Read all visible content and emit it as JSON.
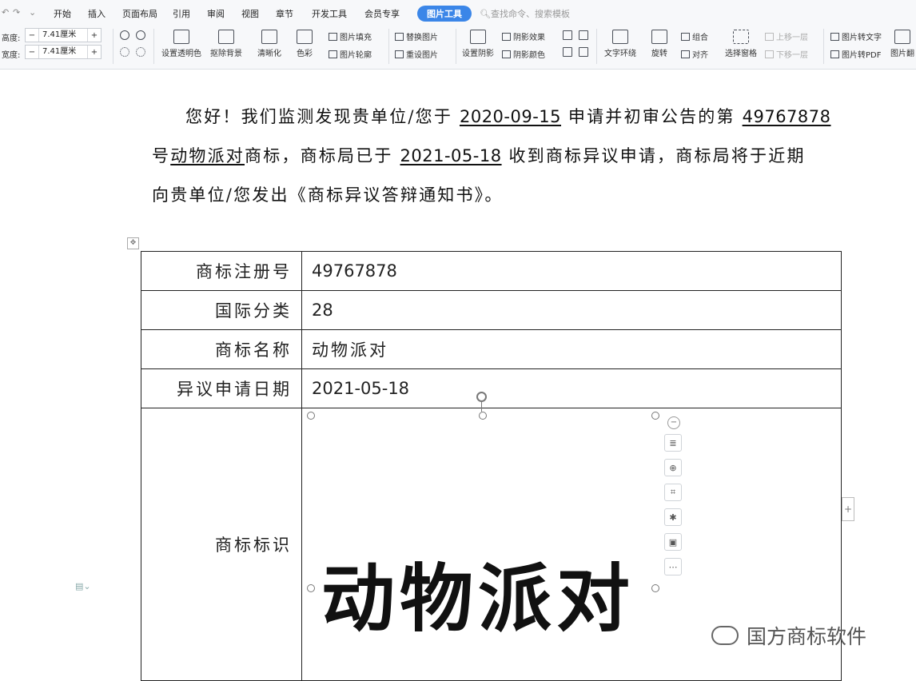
{
  "menubar": {
    "tabs": [
      "开始",
      "插入",
      "页面布局",
      "引用",
      "审阅",
      "视图",
      "章节",
      "开发工具",
      "会员专享"
    ],
    "active_tab": "图片工具",
    "search_placeholder": "查找命令、搜索模板"
  },
  "toolbar": {
    "height_label": "高度:",
    "height_value": "7.41厘米",
    "width_label": "宽度:",
    "width_value": "7.41厘米",
    "set_transparent": "设置透明色",
    "remove_bg": "抠除背景",
    "sharpen": "清晰化",
    "color": "色彩",
    "fill": "图片填充",
    "outline": "图片轮廓",
    "replace": "替换图片",
    "reset": "重设图片",
    "set_shadow": "设置阴影",
    "shadow_effect": "阴影效果",
    "shadow_color": "阴影颜色",
    "text_wrap": "文字环绕",
    "rotate": "旋转",
    "group": "组合",
    "align": "对齐",
    "select_pane": "选择窗格",
    "bring_forward": "上移一层",
    "send_backward": "下移一层",
    "pic_to_text": "图片转文字",
    "pic_to_pdf": "图片转PDF",
    "pic_more": "图片翻"
  },
  "document": {
    "line1_a": "您好！我们监测发现贵单位/您于",
    "line1_date": "2020-09-15",
    "line1_b": "申请并初审公告的第",
    "line1_num": "49767878",
    "line2_a": "号",
    "line2_name": "动物派对",
    "line2_b": "商标，商标局已于",
    "line2_date": "2021-05-18",
    "line2_c": "收到商标异议申请，商标局将于近期",
    "line3": "向贵单位/您发出《商标异议答辩通知书》。"
  },
  "table": {
    "rows": [
      {
        "key": "商标注册号",
        "value": "49767878"
      },
      {
        "key": "国际分类",
        "value": "28"
      },
      {
        "key": "商标名称",
        "value": "动物派对"
      },
      {
        "key": "异议申请日期",
        "value": "2021-05-18"
      }
    ],
    "image_row_key": "商标标识",
    "logo_text": "动物派对"
  },
  "watermark": "国方商标软件"
}
